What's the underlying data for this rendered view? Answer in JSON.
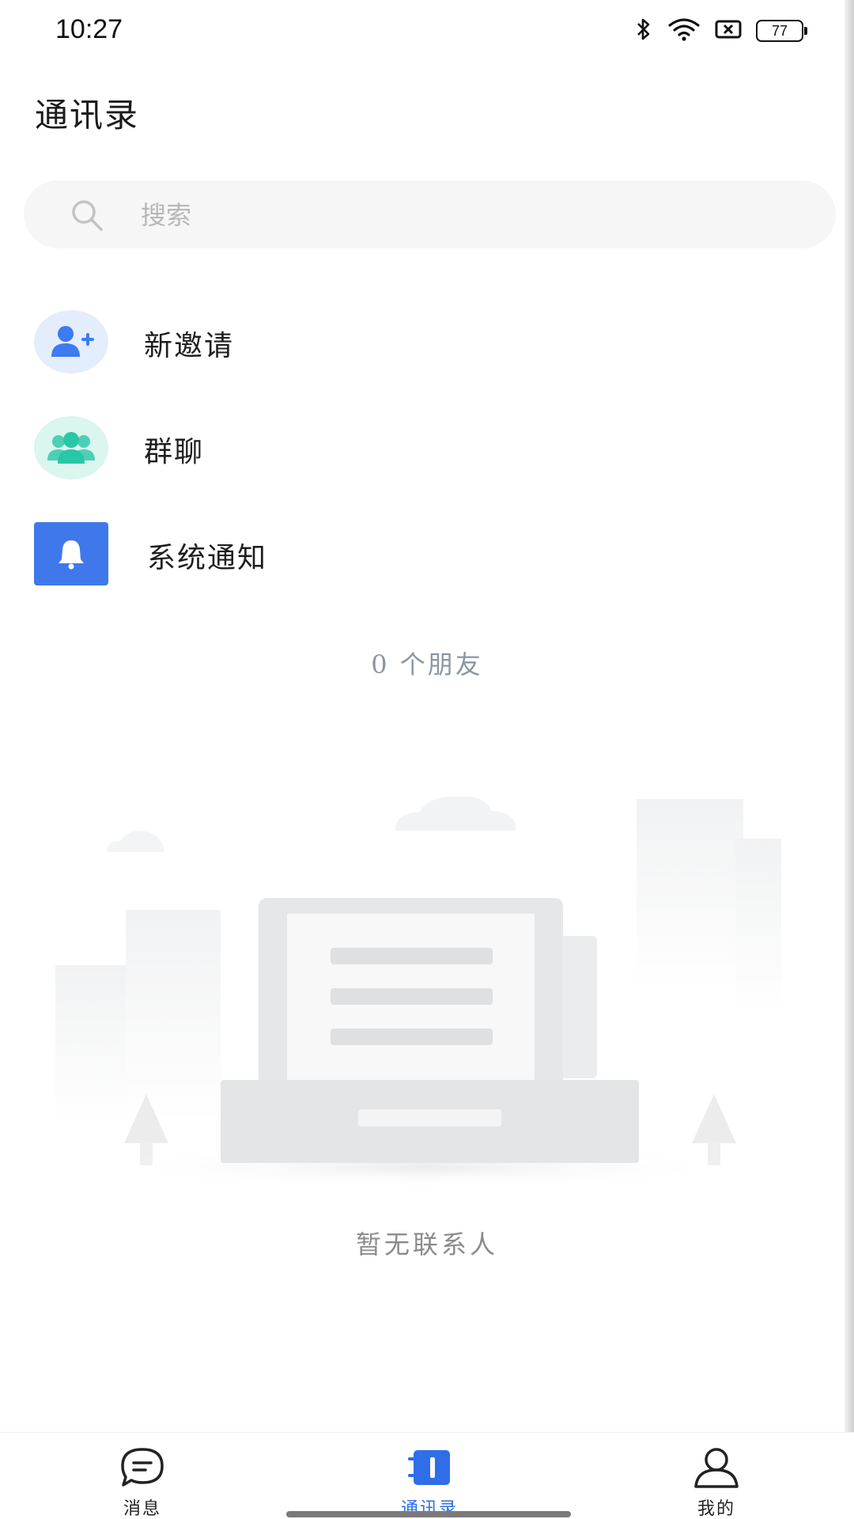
{
  "status_bar": {
    "time": "10:27",
    "battery": "77",
    "icons": [
      "bluetooth-icon",
      "wifi-icon",
      "no-sim-icon",
      "battery-icon"
    ]
  },
  "header": {
    "title": "通讯录"
  },
  "search": {
    "placeholder": "搜索",
    "value": ""
  },
  "entries": [
    {
      "label": "新邀请",
      "icon": "add-person-icon",
      "color": "#3c7bf0",
      "bg": "#e4edfc"
    },
    {
      "label": "群聊",
      "icon": "group-icon",
      "color": "#28c7a6",
      "bg": "#dbf5ef"
    },
    {
      "label": "系统通知",
      "icon": "bell-icon",
      "color": "#ffffff",
      "bg": "#3f78ea"
    }
  ],
  "friends": {
    "count_text": "0 个朋友"
  },
  "empty_state": {
    "text": "暂无联系人"
  },
  "bottom_nav": {
    "active_color": "#2f6ee8",
    "items": [
      {
        "label": "消息",
        "icon": "chat-bubble-icon",
        "active": false
      },
      {
        "label": "通讯录",
        "icon": "contacts-book-icon",
        "active": true
      },
      {
        "label": "我的",
        "icon": "person-icon",
        "active": false
      }
    ]
  }
}
